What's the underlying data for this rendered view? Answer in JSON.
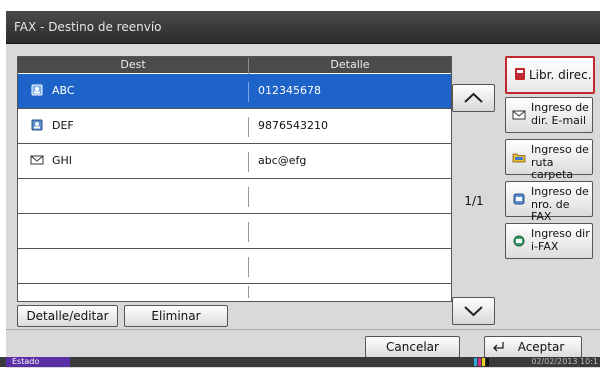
{
  "window": {
    "title": "FAX - Destino de reenvío"
  },
  "table": {
    "headers": [
      "Dest",
      "Detalle"
    ],
    "rows": [
      {
        "icon": "address-book-icon",
        "dest": "ABC",
        "detail": "012345678",
        "selected": true
      },
      {
        "icon": "address-book-icon",
        "dest": "DEF",
        "detail": "9876543210",
        "selected": false
      },
      {
        "icon": "envelope-icon",
        "dest": "GHI",
        "detail": "abc@efg",
        "selected": false
      },
      {
        "icon": "",
        "dest": "",
        "detail": "",
        "selected": false
      },
      {
        "icon": "",
        "dest": "",
        "detail": "",
        "selected": false
      },
      {
        "icon": "",
        "dest": "",
        "detail": "",
        "selected": false
      },
      {
        "icon": "",
        "dest": "",
        "detail": "",
        "selected": false
      }
    ],
    "page_indicator": "1/1"
  },
  "side_buttons": {
    "addr_book": "Libr. direc.",
    "email_l1": "Ingreso de",
    "email_l2": "dir. E-mail",
    "folder_l1": "Ingreso de",
    "folder_l2": "ruta carpeta",
    "fax_l1": "Ingreso de",
    "fax_l2": "nro. de FAX",
    "ifax_l1": "Ingreso dir",
    "ifax_l2": "i-FAX"
  },
  "bottom": {
    "detail_edit": "Detalle/editar",
    "delete": "Eliminar",
    "cancel": "Cancelar",
    "accept": "Aceptar"
  },
  "status_bar": {
    "status": "Estado",
    "datetime": "02/02/2013  10:1"
  },
  "colors": {
    "selection": "#1e63c8",
    "accent_red": "#c0282e",
    "status_purple": "#5a2fa6"
  }
}
